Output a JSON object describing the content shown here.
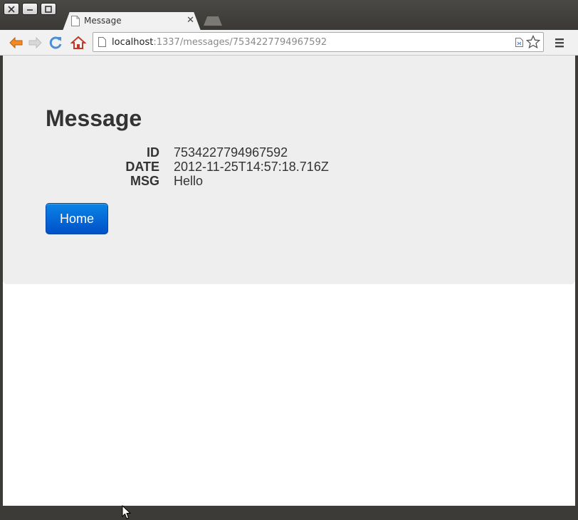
{
  "window": {
    "controls": [
      "close-icon",
      "minimize-icon",
      "maximize-icon"
    ]
  },
  "tab": {
    "title": "Message",
    "favicon": "document-icon"
  },
  "toolbar": {
    "url_host": "localhost",
    "url_rest": ":1337/messages/7534227794967592",
    "icons": [
      "back-arrow-icon",
      "forward-arrow-icon",
      "reload-icon",
      "home-icon",
      "page-action-icon",
      "star-icon",
      "menu-icon"
    ]
  },
  "page": {
    "heading": "Message",
    "fields": [
      {
        "label": "ID",
        "value": "7534227794967592"
      },
      {
        "label": "DATE",
        "value": "2012-11-25T14:57:18.716Z"
      },
      {
        "label": "MSG",
        "value": "Hello"
      }
    ],
    "home_button": "Home"
  },
  "colors": {
    "button_primary": "#0a6fe0",
    "hero_background": "#eeeeee",
    "text": "#333333"
  }
}
